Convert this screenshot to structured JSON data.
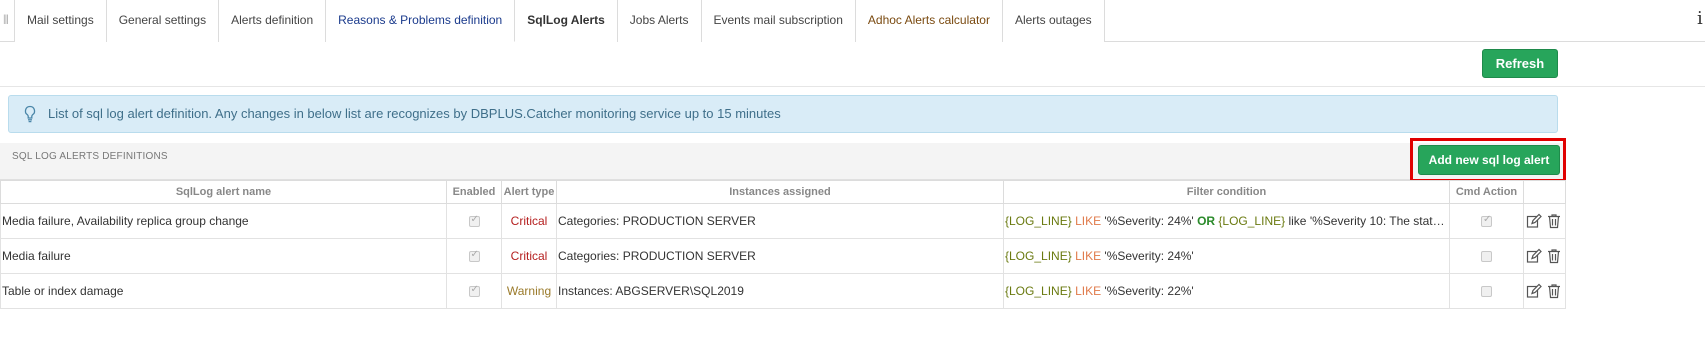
{
  "tabs": [
    {
      "label": "Mail settings",
      "style": "normal"
    },
    {
      "label": "General settings",
      "style": "normal"
    },
    {
      "label": "Alerts definition",
      "style": "normal"
    },
    {
      "label": "Reasons & Problems definition",
      "style": "blue"
    },
    {
      "label": "SqlLog Alerts",
      "style": "active"
    },
    {
      "label": "Jobs Alerts",
      "style": "normal"
    },
    {
      "label": "Events mail subscription",
      "style": "normal"
    },
    {
      "label": "Adhoc Alerts calculator",
      "style": "brown"
    },
    {
      "label": "Alerts outages",
      "style": "normal"
    }
  ],
  "toolbar": {
    "refresh_label": "Refresh"
  },
  "info_message": "List of sql log alert definition. Any changes in below list are recognizes by DBPLUS.Catcher monitoring service up to 15 minutes",
  "section": {
    "title": "SQL LOG ALERTS DEFINITIONS",
    "add_button_label": "Add new sql log alert"
  },
  "table": {
    "headers": {
      "name": "SqlLog alert name",
      "enabled": "Enabled",
      "type": "Alert type",
      "instances": "Instances assigned",
      "filter": "Filter condition",
      "cmd": "Cmd Action"
    },
    "rows": [
      {
        "name": "Media failure, Availability replica group change",
        "enabled": true,
        "type": "Critical",
        "instances": "Categories: PRODUCTION SERVER",
        "filter": {
          "f1": "{LOG_LINE}",
          "op1": "LIKE",
          "v1": "'%Severity: 24%'",
          "or": "OR",
          "f2": "{LOG_LINE}",
          "op2": "like",
          "v2": "'%Severity 10: The state of the…"
        },
        "cmd": true
      },
      {
        "name": "Media failure",
        "enabled": true,
        "type": "Critical",
        "instances": "Categories: PRODUCTION SERVER",
        "filter": {
          "f1": "{LOG_LINE}",
          "op1": "LIKE",
          "v1": "'%Severity: 24%'"
        },
        "cmd": false
      },
      {
        "name": "Table or index damage",
        "enabled": true,
        "type": "Warning",
        "instances": "Instances: ABGSERVER\\SQL2019",
        "filter": {
          "f1": "{LOG_LINE}",
          "op1": "LIKE",
          "v1": "'%Severity: 22%'"
        },
        "cmd": false
      }
    ]
  },
  "colors": {
    "accent_green": "#27a55b",
    "critical": "#b52020",
    "warning": "#9a7a2a",
    "highlight_frame": "#e00000"
  },
  "icons": {
    "edit": "pencil-square-icon",
    "delete": "trash-icon",
    "info": "info-icon",
    "bulb": "lightbulb-icon"
  }
}
